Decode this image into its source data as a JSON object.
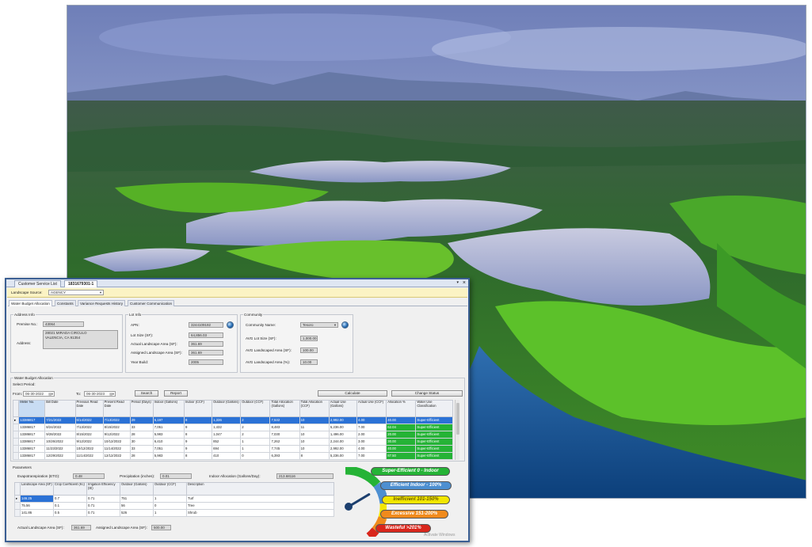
{
  "tabs": {
    "customer_service_list": "Customer Service List",
    "account": "1831679301-1"
  },
  "landscape_source": {
    "label": "Landscape Source:",
    "value": "AGENCY"
  },
  "subtabs": [
    "Water Budget Allocation",
    "Constants",
    "Variance Requests History",
    "Customer Communication"
  ],
  "address_info": {
    "title": "Address Info",
    "premise_no_label": "Premise No.:",
    "premise_no": "43064",
    "address_label": "Address:",
    "address_line1": "28021 MIRADA CIRCULO",
    "address_line2": "VALENCIA, CA 91354"
  },
  "lot_info": {
    "title": "Lot Info",
    "apn_label": "APN:",
    "apn": "3244109192",
    "lot_size_label": "Lot Size (SF):",
    "lot_size": "64,856.03",
    "actual_landscape_area_label": "Actual Landscape Area (SF):",
    "actual_landscape_area": "361.69",
    "assigned_landscape_area_label": "Assigned Landscape Area (SF):",
    "assigned_landscape_area": "361.69",
    "year_build_label": "Year Build:",
    "year_build": "2005"
  },
  "community": {
    "title": "Community",
    "community_name_label": "Community Name:",
    "community_name": "Tesoro",
    "avg_lot_size_label": "AVG Lot Size (SF):",
    "avg_lot_size": "1,000.00",
    "avg_landscaped_area_label": "AVG Landscaped Area (SF):",
    "avg_landscaped_area": "100.00",
    "avg_landscaped_area_pct_label": "AVG Landscaped Area (%):",
    "avg_landscaped_area_pct": "10.00"
  },
  "wba": {
    "title": "Water Budget Allocation",
    "select_period_label": "Select Period:",
    "from_label": "From:",
    "from_date": "06-30-2022",
    "to_label": "To:",
    "to_date": "06-30-2023",
    "search_button": "Search",
    "report_button": "Report",
    "calculate_button": "Calculate",
    "change_status_button": "Change Status",
    "columns": [
      "Meter No.",
      "Bill Date",
      "Previous Read Date",
      "Present Read Date",
      "Period (Days)",
      "Indoor (Gallons)",
      "Indoor (CCF)",
      "Outdoor (Gallons)",
      "Outdoor (CCF)",
      "Total Allocation (Gallons)",
      "Total Allocation (CCF)",
      "Actual Use (Gallons)",
      "Actual Use (CCF)",
      "Allocation %",
      "Water Use Classification"
    ],
    "rows": [
      [
        "13386817",
        "7/21/2022",
        "6/14/2022",
        "7/13/2022",
        "29",
        "6,197",
        "8",
        "1,336",
        "2",
        "7,532",
        "10",
        "2,992.00",
        "4.00",
        "40.00",
        "Super-Efficient"
      ],
      [
        "13386817",
        "8/24/2022",
        "7/13/2022",
        "8/15/2022",
        "33",
        "7,051",
        "9",
        "1,432",
        "2",
        "8,483",
        "11",
        "5,236.00",
        "7.00",
        "62.04",
        "Super-Efficient"
      ],
      [
        "13386817",
        "9/28/2022",
        "8/15/2022",
        "9/12/2022",
        "28",
        "5,983",
        "8",
        "1,047",
        "2",
        "7,030",
        "10",
        "1,496.00",
        "2.00",
        "20.00",
        "Super-Efficient"
      ],
      [
        "13386817",
        "10/26/2022",
        "9/12/2022",
        "10/12/2022",
        "30",
        "6,410",
        "9",
        "852",
        "1",
        "7,262",
        "10",
        "2,244.00",
        "3.00",
        "30.00",
        "Super-Efficient"
      ],
      [
        "13386817",
        "11/23/2022",
        "10/12/2022",
        "11/14/2022",
        "33",
        "7,051",
        "9",
        "694",
        "1",
        "7,745",
        "10",
        "2,992.00",
        "4.00",
        "40.00",
        "Super-Efficient"
      ],
      [
        "13386817",
        "12/29/2022",
        "11/14/2022",
        "12/12/2022",
        "28",
        "5,983",
        "8",
        "410",
        "0",
        "6,393",
        "8",
        "5,236.00",
        "7.00",
        "87.50",
        "Super-Efficient"
      ]
    ]
  },
  "parameters": {
    "title": "Parameters",
    "eto_label": "Evapotranspiration (ETO):",
    "eto": "0.48",
    "precipitation_label": "Precipitation (inches):",
    "precipitation": "0.01",
    "indoor_allocation_label": "Indoor Allocation (Gallons/Day):",
    "indoor_allocation": "213.68116",
    "columns": [
      "Landscape Area (SF)",
      "Crop Coefficient (Kc)",
      "Irrigation Efficiency (IE)",
      "Outdoor (Gallons)",
      "Outdoor (CCF)",
      "Description"
    ],
    "rows": [
      [
        "146.25",
        "0.7",
        "0.71",
        "751",
        "1",
        "Turf"
      ],
      [
        "75.56",
        "0.1",
        "0.71",
        "56",
        "0",
        "Tree"
      ],
      [
        "141.86",
        "0.5",
        "0.71",
        "526",
        "1",
        "Shrub"
      ]
    ]
  },
  "footer": {
    "actual_landscape_area_label": "Actual Landscape Area (SF):",
    "actual_landscape_area": "361.69",
    "assigned_landscape_area_label": "Assigned Landscape Area (SF):",
    "assigned_landscape_area": "500.00"
  },
  "legend": {
    "super_efficient": "Super-Efficient",
    "super_efficient_range": "0 - Indoor",
    "efficient": "Efficient",
    "efficient_range": "Indoor - 100%",
    "inefficient": "Inefficient",
    "inefficient_range": "101-150%",
    "excessive": "Excessive",
    "excessive_range": "151-200%",
    "wasteful": "Wasteful",
    "wasteful_range": ">201%"
  },
  "watermark": "Activate Windows",
  "gauge": {
    "needle_fraction": 0.28
  },
  "colors": {
    "accent_blue": "#2b72d6",
    "super_efficient_green": "#25b336",
    "efficient_blue": "#4d8fd1",
    "inefficient_yellow": "#f2e600",
    "excessive_orange": "#f08a1c",
    "wasteful_red": "#d9261c"
  }
}
